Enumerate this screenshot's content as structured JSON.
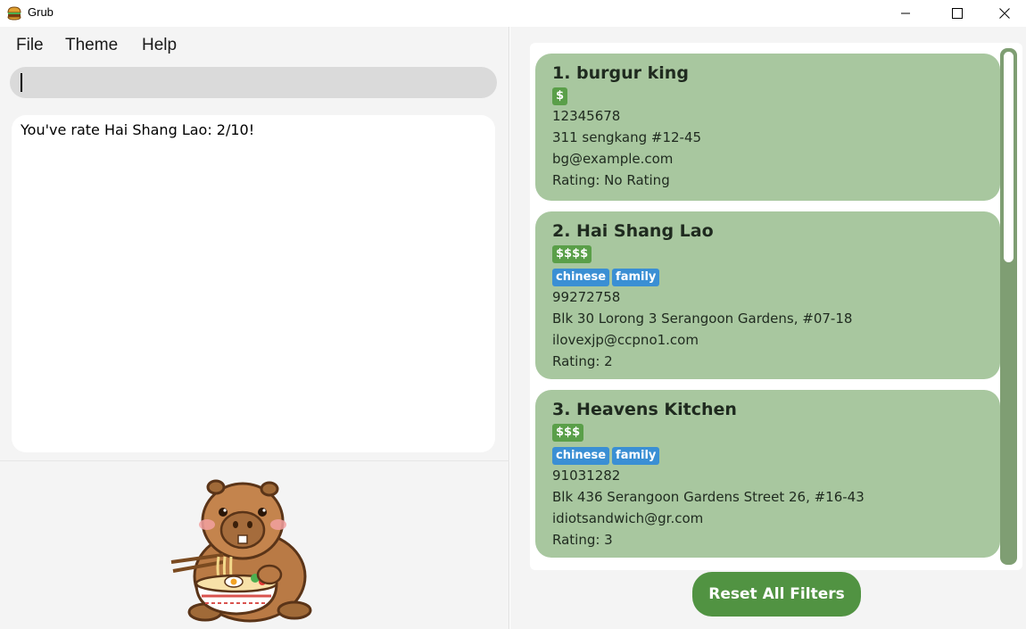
{
  "window": {
    "title": "Grub",
    "icon": "burger-icon"
  },
  "menu": {
    "file": "File",
    "theme": "Theme",
    "help": "Help"
  },
  "command": {
    "value": ""
  },
  "result": {
    "message": "You've rate Hai Shang Lao: 2/10!"
  },
  "mascot": {
    "icon": "capybara-eating-noodles-mascot"
  },
  "restaurants": [
    {
      "name": "1. burgur king",
      "price": "$",
      "tags": [],
      "phone": "12345678",
      "address": "311 sengkang #12-45",
      "email": "bg@example.com",
      "rating": "Rating: No Rating"
    },
    {
      "name": "2. Hai Shang Lao",
      "price": "$$$$",
      "tags": [
        "chinese",
        "family"
      ],
      "phone": "99272758",
      "address": "Blk 30 Lorong 3 Serangoon Gardens, #07-18",
      "email": "ilovexjp@ccpno1.com",
      "rating": "Rating: 2"
    },
    {
      "name": "3. Heavens Kitchen",
      "price": "$$$",
      "tags": [
        "chinese",
        "family"
      ],
      "phone": "91031282",
      "address": "Blk 436 Serangoon Gardens Street 26, #16-43",
      "email": "idiotsandwich@gr.com",
      "rating": "Rating: 3"
    }
  ],
  "reset_button": "Reset All Filters",
  "colors": {
    "card": "#a8c79f",
    "price_badge": "#5a9f49",
    "tag_badge": "#3a8fd4",
    "reset_button": "#519342",
    "scrollbar": "#7f9e73"
  }
}
